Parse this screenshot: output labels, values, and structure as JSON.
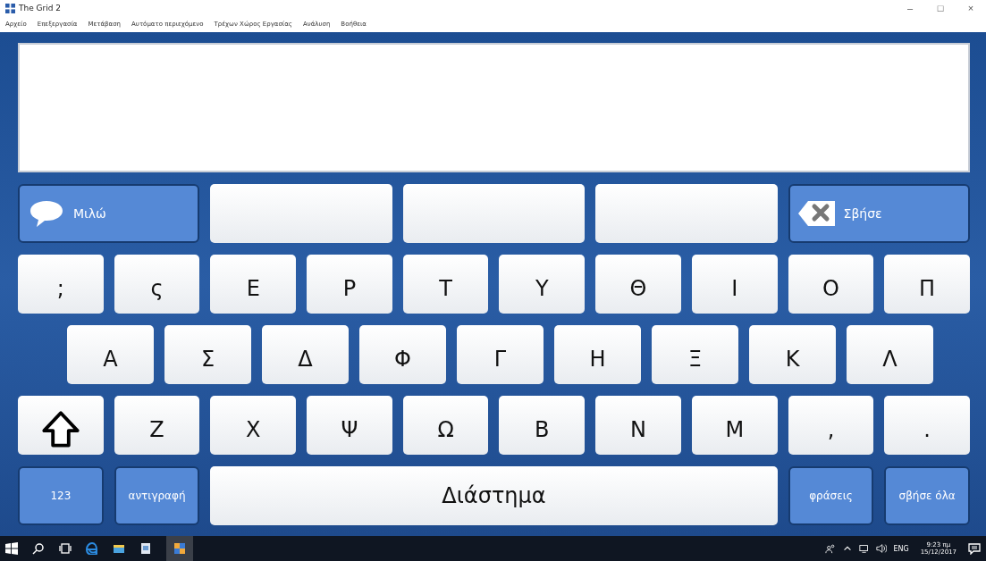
{
  "window": {
    "title": "The Grid 2",
    "controls": [
      "–",
      "□",
      "×"
    ]
  },
  "menu": [
    "Αρχείο",
    "Επεξεργασία",
    "Μετάβαση",
    "Αυτόματο περιεχόμενο",
    "Τρέχων Χώρος Εργασίας",
    "Ανάλυση",
    "Βοήθεια"
  ],
  "top_row": [
    {
      "kind": "speak",
      "label": "Μιλώ"
    },
    {
      "kind": "blank"
    },
    {
      "kind": "blank"
    },
    {
      "kind": "blank"
    },
    {
      "kind": "delete",
      "label": "Σβήσε"
    }
  ],
  "key_rows": [
    [
      {
        "kind": "letter",
        "label": ";"
      },
      {
        "kind": "letter",
        "label": "ς"
      },
      {
        "kind": "letter",
        "label": "Ε"
      },
      {
        "kind": "letter",
        "label": "Ρ"
      },
      {
        "kind": "letter",
        "label": "Τ"
      },
      {
        "kind": "letter",
        "label": "Υ"
      },
      {
        "kind": "letter",
        "label": "Θ"
      },
      {
        "kind": "letter",
        "label": "Ι"
      },
      {
        "kind": "letter",
        "label": "Ο"
      },
      {
        "kind": "letter",
        "label": "Π"
      }
    ],
    [
      {
        "kind": "letter",
        "label": "Α"
      },
      {
        "kind": "letter",
        "label": "Σ"
      },
      {
        "kind": "letter",
        "label": "Δ"
      },
      {
        "kind": "letter",
        "label": "Φ"
      },
      {
        "kind": "letter",
        "label": "Γ"
      },
      {
        "kind": "letter",
        "label": "Η"
      },
      {
        "kind": "letter",
        "label": "Ξ"
      },
      {
        "kind": "letter",
        "label": "Κ"
      },
      {
        "kind": "letter",
        "label": "Λ"
      }
    ],
    [
      {
        "kind": "shift"
      },
      {
        "kind": "letter",
        "label": "Ζ"
      },
      {
        "kind": "letter",
        "label": "Χ"
      },
      {
        "kind": "letter",
        "label": "Ψ"
      },
      {
        "kind": "letter",
        "label": "Ω"
      },
      {
        "kind": "letter",
        "label": "Β"
      },
      {
        "kind": "letter",
        "label": "Ν"
      },
      {
        "kind": "letter",
        "label": "Μ"
      },
      {
        "kind": "letter",
        "label": ","
      },
      {
        "kind": "letter",
        "label": "."
      }
    ],
    [
      {
        "kind": "action",
        "label": "123"
      },
      {
        "kind": "action",
        "label": "αντιγραφή"
      },
      {
        "kind": "space",
        "label": "Διάστημα"
      },
      {
        "kind": "action",
        "label": "φράσεις"
      },
      {
        "kind": "action",
        "label": "σβήσε όλα"
      }
    ]
  ],
  "taskbar": {
    "language": "ENG",
    "time": "9:23 πμ",
    "date": "15/12/2017"
  }
}
